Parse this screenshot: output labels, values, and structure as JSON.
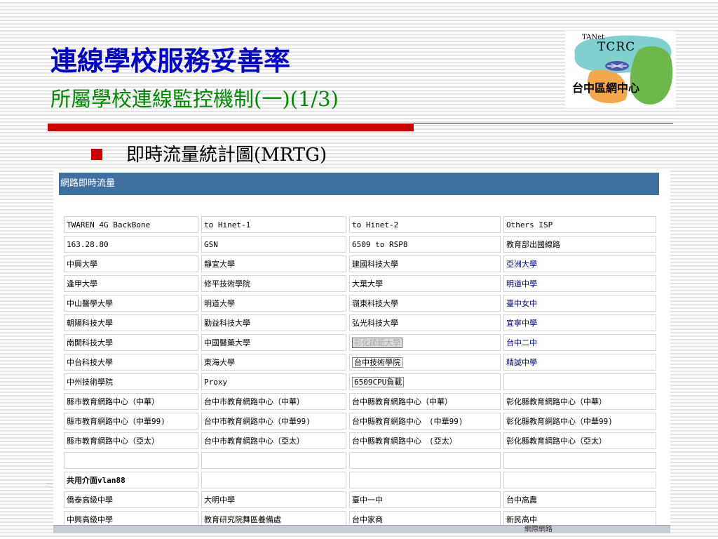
{
  "slide": {
    "title": "連線學校服務妥善率",
    "subtitle": "所屬學校連線監控機制(一)(1/3)",
    "bullet": "即時流量統計圖(MRTG)"
  },
  "logo": {
    "tanet": "TANet",
    "tcrc": "TCRC",
    "center_name": "台中區網中心"
  },
  "panel": {
    "header": "網路即時流量",
    "rows": [
      [
        "TWAREN 4G BackBone",
        "to Hinet-1",
        "to Hinet-2",
        "Others ISP"
      ],
      [
        "163.28.80",
        "GSN",
        "6509 to RSP8",
        "教育部出國線路"
      ],
      [
        "中興大學",
        "靜宜大學",
        "建國科技大學",
        "亞洲大學"
      ],
      [
        "逢甲大學",
        "修平技術學院",
        "大葉大學",
        "明道中學"
      ],
      [
        "中山醫學大學",
        "明道大學",
        "嶺東科技大學",
        "臺中女中"
      ],
      [
        "朝陽科技大學",
        "勤益科技大學",
        "弘光科技大學",
        "宜寧中學"
      ],
      [
        "南開科技大學",
        "中國醫藥大學",
        "彰化師範大學",
        "台中二中"
      ],
      [
        "中台科技大學",
        "東海大學",
        "台中技術學院",
        "精誠中學"
      ],
      [
        "中州技術學院",
        "Proxy",
        "6509CPU負載",
        ""
      ],
      [
        "縣市教育網路中心（中華）",
        "台中市教育網路中心（中華）",
        "台中縣教育網路中心（中華）",
        "彰化縣教育網路中心（中華）"
      ],
      [
        "縣市教育網路中心（中華99)",
        "台中市教育網路中心（中華99)",
        "台中縣教育網路中心　(中華99)",
        "彰化縣教育網路中心（中華99)"
      ],
      [
        "縣市教育網路中心（亞太）",
        "台中市教育網路中心（亞太）",
        "台中縣教育網路中心　(亞太）",
        "彰化縣教育網路中心（亞太）"
      ],
      [
        "",
        "",
        "",
        ""
      ],
      [
        "共用介面vlan88",
        "",
        "",
        ""
      ],
      [
        "僑泰高級中學",
        "大明中學",
        "臺中一中",
        "台中高農"
      ],
      [
        "中興高級中學",
        "教育研究院舞區養備處",
        "台中家商",
        "新民高中"
      ]
    ]
  },
  "status_bar": {
    "label": "網際網路"
  },
  "colors": {
    "title": "#0000cc",
    "subtitle": "#008800",
    "accent_rule": "#cc0000",
    "panel_header": "#3d6f9f"
  }
}
